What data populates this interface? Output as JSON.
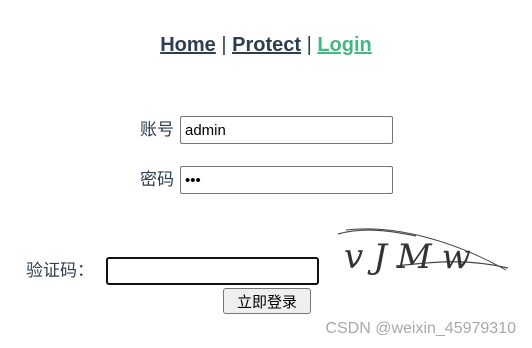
{
  "nav": {
    "home": "Home",
    "protect": "Protect",
    "login": "Login",
    "separator": "|"
  },
  "form": {
    "account_label": "账号",
    "account_value": "admin",
    "password_label": "密码",
    "password_value": "123",
    "captcha_label": "验证码：",
    "captcha_value": "",
    "captcha_image_text": "vJMw",
    "submit_label": "立即登录"
  },
  "watermark": "CSDN @weixin_45979310",
  "colors": {
    "text": "#2c3e50",
    "active_link": "#42b983"
  }
}
